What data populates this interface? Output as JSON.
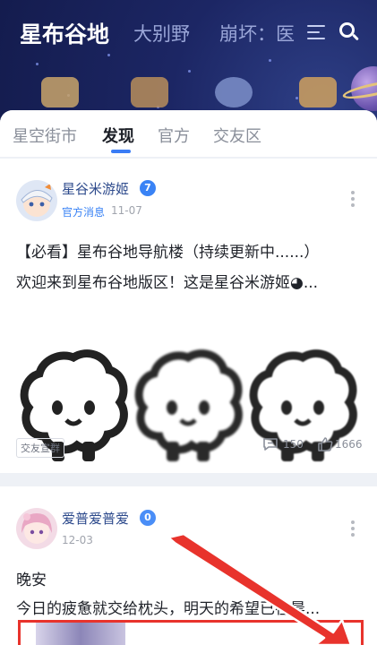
{
  "header": {
    "tabs": [
      {
        "label": "星布谷地",
        "active": true
      },
      {
        "label": "大别野",
        "active": false
      },
      {
        "label": "崩坏：医",
        "active": false
      }
    ],
    "icons": [
      "menu-icon",
      "search-icon"
    ]
  },
  "subtabs": {
    "items": [
      "星空街市",
      "发现",
      "官方",
      "交友区"
    ],
    "active": "发现"
  },
  "posts": [
    {
      "author": "星谷米游姬",
      "verify_mark": "7",
      "tag": "官方消息",
      "date": "11-07",
      "title": "【必看】星布谷地导航楼（持续更新中......）",
      "excerpt": "欢迎来到星布谷地版区！这是星谷米游姬◕...",
      "forum_tag": "交友宣群",
      "comments": "150",
      "likes": "1666"
    },
    {
      "author": "爱普爱普爱",
      "verify_mark": "0",
      "date": "12-03",
      "title": "晚安",
      "excerpt": "今日的疲惫就交给枕头，明天的希望已在晨..."
    }
  ],
  "colors": {
    "accent": "#3a7cf5",
    "header_bg": "#1c2664",
    "annotation_red": "#e8332c"
  }
}
